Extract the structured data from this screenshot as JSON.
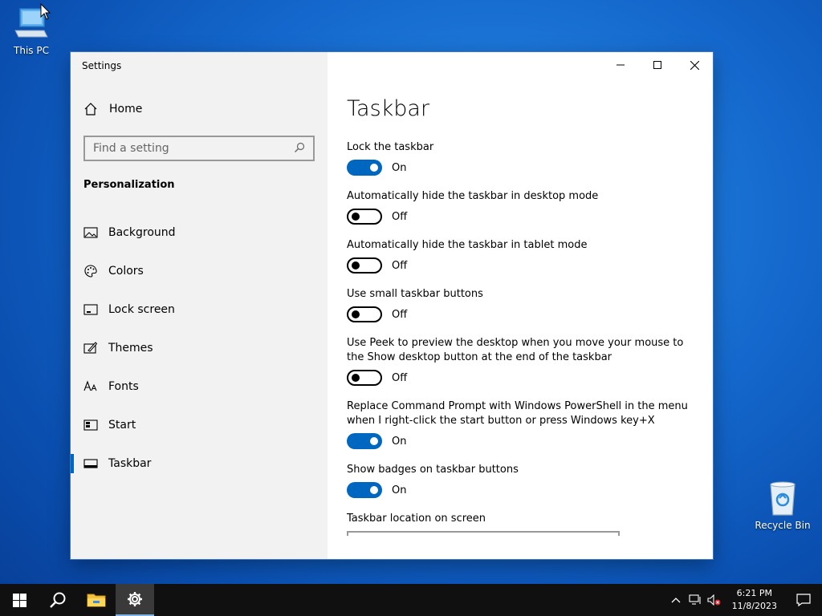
{
  "desktop": {
    "this_pc_label": "This PC",
    "recycle_bin_label": "Recycle Bin"
  },
  "window": {
    "title": "Settings",
    "controls": [
      "minimize",
      "maximize",
      "close"
    ]
  },
  "sidebar": {
    "home_label": "Home",
    "search_placeholder": "Find a setting",
    "section_title": "Personalization",
    "items": [
      {
        "label": "Background",
        "icon": "picture-icon"
      },
      {
        "label": "Colors",
        "icon": "palette-icon"
      },
      {
        "label": "Lock screen",
        "icon": "lock-screen-icon"
      },
      {
        "label": "Themes",
        "icon": "themes-icon"
      },
      {
        "label": "Fonts",
        "icon": "fonts-icon"
      },
      {
        "label": "Start",
        "icon": "start-icon"
      },
      {
        "label": "Taskbar",
        "icon": "taskbar-icon",
        "active": true
      }
    ]
  },
  "main": {
    "title": "Taskbar",
    "settings": [
      {
        "label": "Lock the taskbar",
        "state": "On"
      },
      {
        "label": "Automatically hide the taskbar in desktop mode",
        "state": "Off"
      },
      {
        "label": "Automatically hide the taskbar in tablet mode",
        "state": "Off"
      },
      {
        "label": "Use small taskbar buttons",
        "state": "Off"
      },
      {
        "label": "Use Peek to preview the desktop when you move your mouse to the Show desktop button at the end of the taskbar",
        "state": "Off"
      },
      {
        "label": "Replace Command Prompt with Windows PowerShell in the menu when I right-click the start button or press Windows key+X",
        "state": "On"
      },
      {
        "label": "Show badges on taskbar buttons",
        "state": "On"
      }
    ],
    "location_label": "Taskbar location on screen"
  },
  "taskbar": {
    "time": "6:21 PM",
    "date": "11/8/2023"
  },
  "colors": {
    "accent": "#0067c0",
    "taskbar_bg": "#101010",
    "sidebar_bg": "#f2f2f2"
  }
}
